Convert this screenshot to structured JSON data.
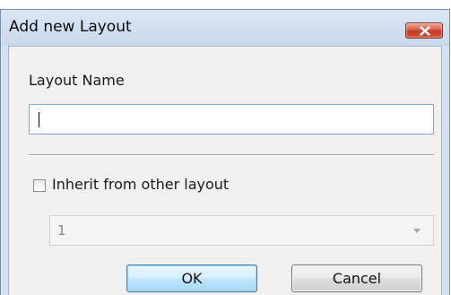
{
  "window": {
    "title": "Add new Layout"
  },
  "form": {
    "layout_name_label": "Layout Name",
    "layout_name_value": "",
    "inherit_label": "Inherit from other layout",
    "inherit_checked": false,
    "inherit_select_value": "1"
  },
  "buttons": {
    "ok_label": "OK",
    "cancel_label": "Cancel"
  },
  "colors": {
    "title_bar": "#d3e0ef",
    "close_button": "#c23a22",
    "ok_button_border": "#3c7fb1"
  },
  "icons": {
    "close": "close-icon",
    "dropdown": "chevron-down-icon"
  }
}
